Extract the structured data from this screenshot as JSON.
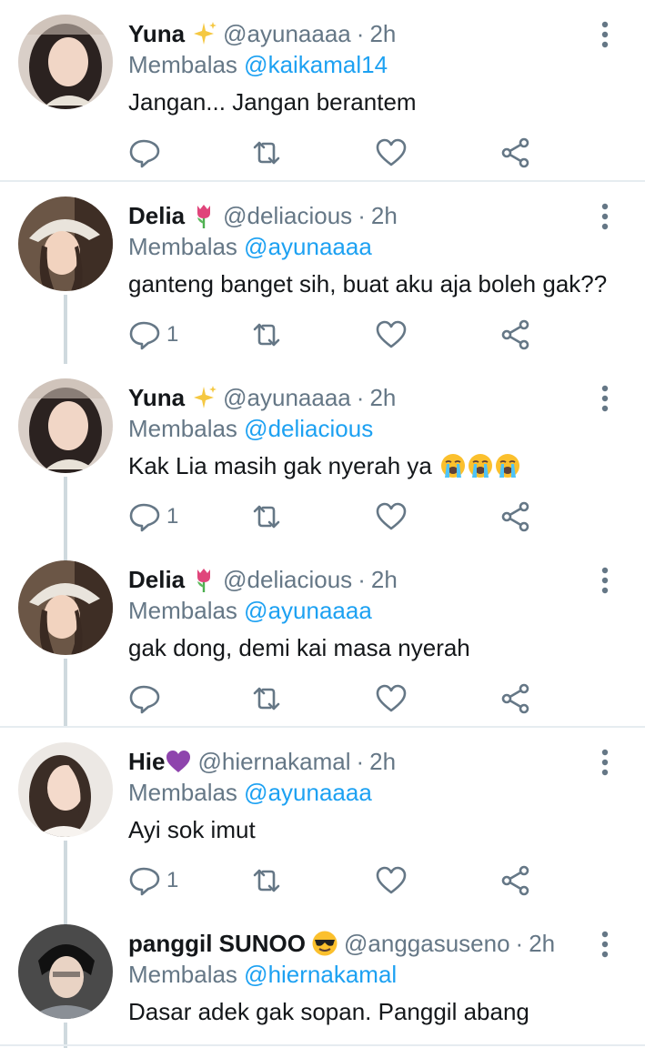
{
  "tweets": [
    {
      "name": "Yuna",
      "name_emoji": "sparkles-icon",
      "handle": "@ayunaaaa",
      "time": "2h",
      "replying_label": "Membalas",
      "replying_to": "@kaikamal14",
      "text": "Jangan... Jangan berantem",
      "reply_count": ""
    },
    {
      "name": "Delia",
      "name_emoji": "tulip-icon",
      "handle": "@deliacious",
      "time": "2h",
      "replying_label": "Membalas",
      "replying_to": "@ayunaaaa",
      "text": "ganteng banget sih, buat aku aja boleh gak??",
      "reply_count": "1"
    },
    {
      "name": "Yuna",
      "name_emoji": "sparkles-icon",
      "handle": "@ayunaaaa",
      "time": "2h",
      "replying_label": "Membalas",
      "replying_to": "@deliacious",
      "text": "Kak Lia masih gak nyerah ya",
      "text_emoji": "loudly-crying-face-icon x3",
      "reply_count": "1"
    },
    {
      "name": "Delia",
      "name_emoji": "tulip-icon",
      "handle": "@deliacious",
      "time": "2h",
      "replying_label": "Membalas",
      "replying_to": "@ayunaaaa",
      "text": "gak dong, demi kai masa nyerah",
      "reply_count": ""
    },
    {
      "name": "Hie",
      "name_emoji": "purple-heart-icon",
      "handle": "@hiernakamal",
      "time": "2h",
      "replying_label": "Membalas",
      "replying_to": "@ayunaaaa",
      "text": "Ayi sok imut",
      "reply_count": "1"
    },
    {
      "name": "panggil SUNOO",
      "name_emoji": "sunglasses-face-icon",
      "handle": "@anggasuseno",
      "time": "2h",
      "replying_label": "Membalas",
      "replying_to": "@hiernakamal",
      "text": "Dasar adek gak sopan. Panggil abang",
      "reply_count": ""
    }
  ],
  "separator": "·",
  "colors": {
    "link": "#1da1f2",
    "muted": "#657786",
    "text": "#14171a",
    "divider": "#e6ecf0",
    "thread": "#cfd9de"
  }
}
